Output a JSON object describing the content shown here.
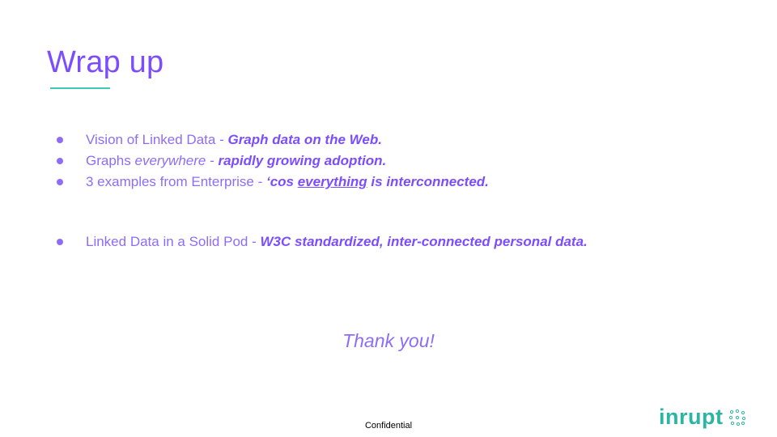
{
  "slide": {
    "title": "Wrap up",
    "bullets": [
      {
        "plain": "Vision of Linked Data - ",
        "bold": "Graph data on the Web."
      },
      {
        "plain_a": "Graphs ",
        "italic": "everywhere",
        "plain_b": " - ",
        "bold": "rapidly growing adoption."
      },
      {
        "plain": "3 examples from Enterprise - ",
        "bold_a": "‘cos ",
        "bold_underlined": "everything",
        "bold_b": " is interconnected."
      },
      {
        "plain": "Linked Data in a Solid Pod - ",
        "bold": "W3C standardized, inter-connected personal data."
      }
    ],
    "thanks": "Thank you!",
    "footer": "Confidential",
    "logo": {
      "text": "inrupt",
      "icon": "dot-cluster-icon"
    }
  },
  "colors": {
    "title": "#7c4dff",
    "text": "#8e6cf7",
    "accent": "#3ec9b4",
    "logo": "#2bb5a2"
  }
}
